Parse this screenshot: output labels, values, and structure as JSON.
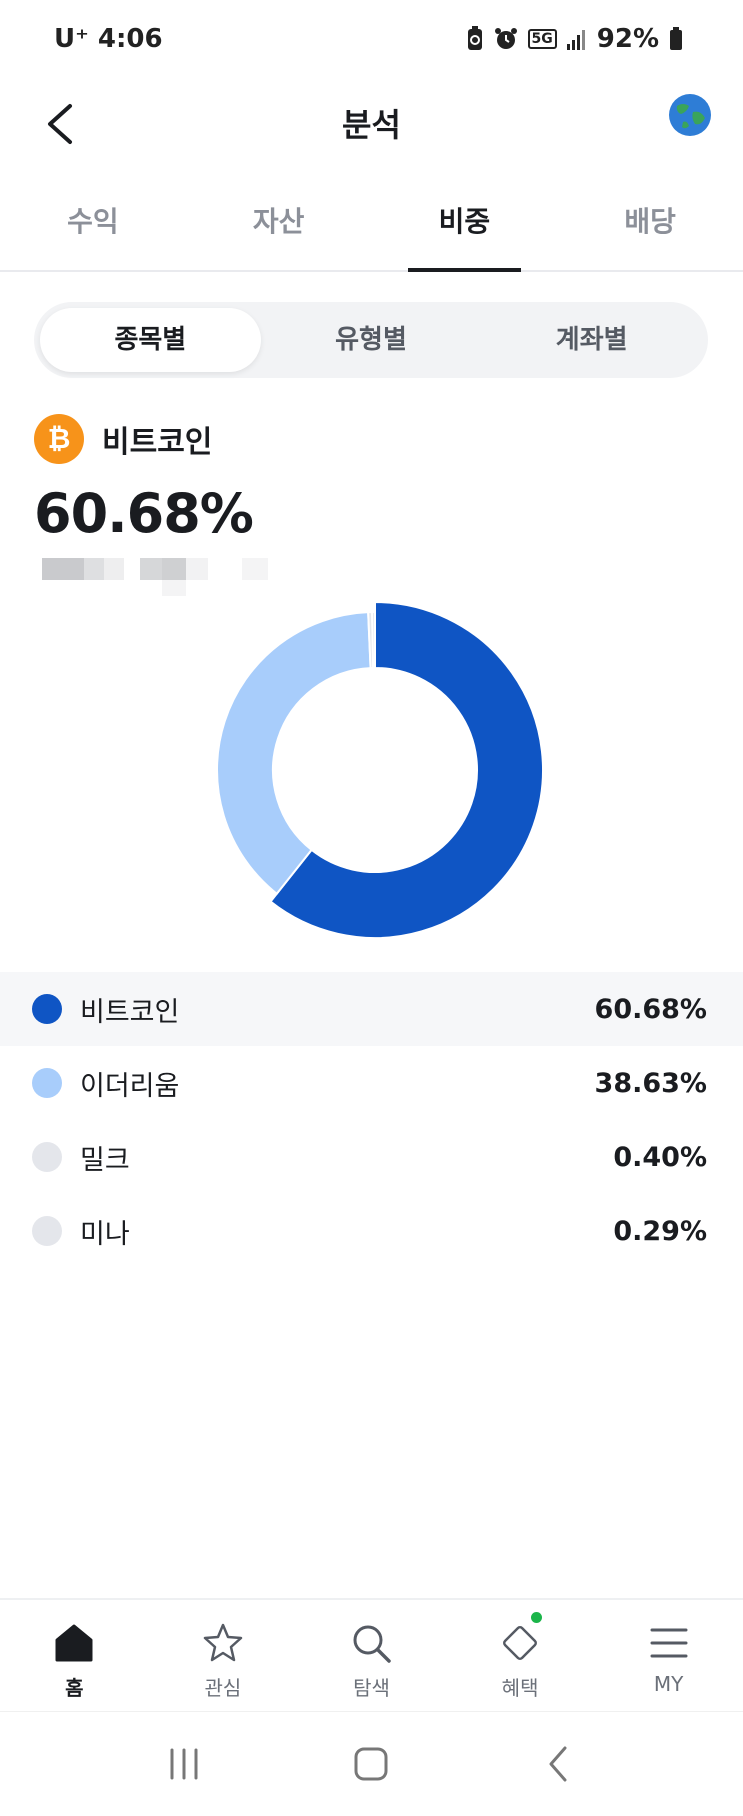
{
  "status": {
    "carrier": "U⁺",
    "time": "4:06",
    "network": "5G",
    "battery": "92%"
  },
  "header": {
    "title": "분석"
  },
  "main_tabs": [
    {
      "label": "수익",
      "active": false
    },
    {
      "label": "자산",
      "active": false
    },
    {
      "label": "비중",
      "active": true
    },
    {
      "label": "배당",
      "active": false
    }
  ],
  "segments": [
    {
      "label": "종목별",
      "active": true
    },
    {
      "label": "유형별",
      "active": false
    },
    {
      "label": "계좌별",
      "active": false
    }
  ],
  "focus": {
    "coin_symbol": "₿",
    "name": "비트코인",
    "percent": "60.68%"
  },
  "chart_data": {
    "type": "pie",
    "style": "donut",
    "categories": [
      "비트코인",
      "이더리움",
      "밀크",
      "미나"
    ],
    "values": [
      60.68,
      38.63,
      0.4,
      0.29
    ],
    "colors": [
      "#0f55c4",
      "#a8cdfb",
      "#e4e6eb",
      "#e4e6eb"
    ],
    "title": "",
    "highlighted": "비트코인"
  },
  "legend": [
    {
      "name": "비트코인",
      "value": "60.68%",
      "color": "#0f55c4"
    },
    {
      "name": "이더리움",
      "value": "38.63%",
      "color": "#a8cdfb"
    },
    {
      "name": "밀크",
      "value": "0.40%",
      "color": "#e4e6eb"
    },
    {
      "name": "미나",
      "value": "0.29%",
      "color": "#e4e6eb"
    }
  ],
  "bottom_nav": [
    {
      "label": "홈",
      "icon": "home-icon",
      "active": true
    },
    {
      "label": "관심",
      "icon": "star-icon",
      "active": false
    },
    {
      "label": "탐색",
      "icon": "search-icon",
      "active": false
    },
    {
      "label": "혜택",
      "icon": "diamond-icon",
      "active": false,
      "badge": true
    },
    {
      "label": "MY",
      "icon": "menu-icon",
      "active": false
    }
  ]
}
